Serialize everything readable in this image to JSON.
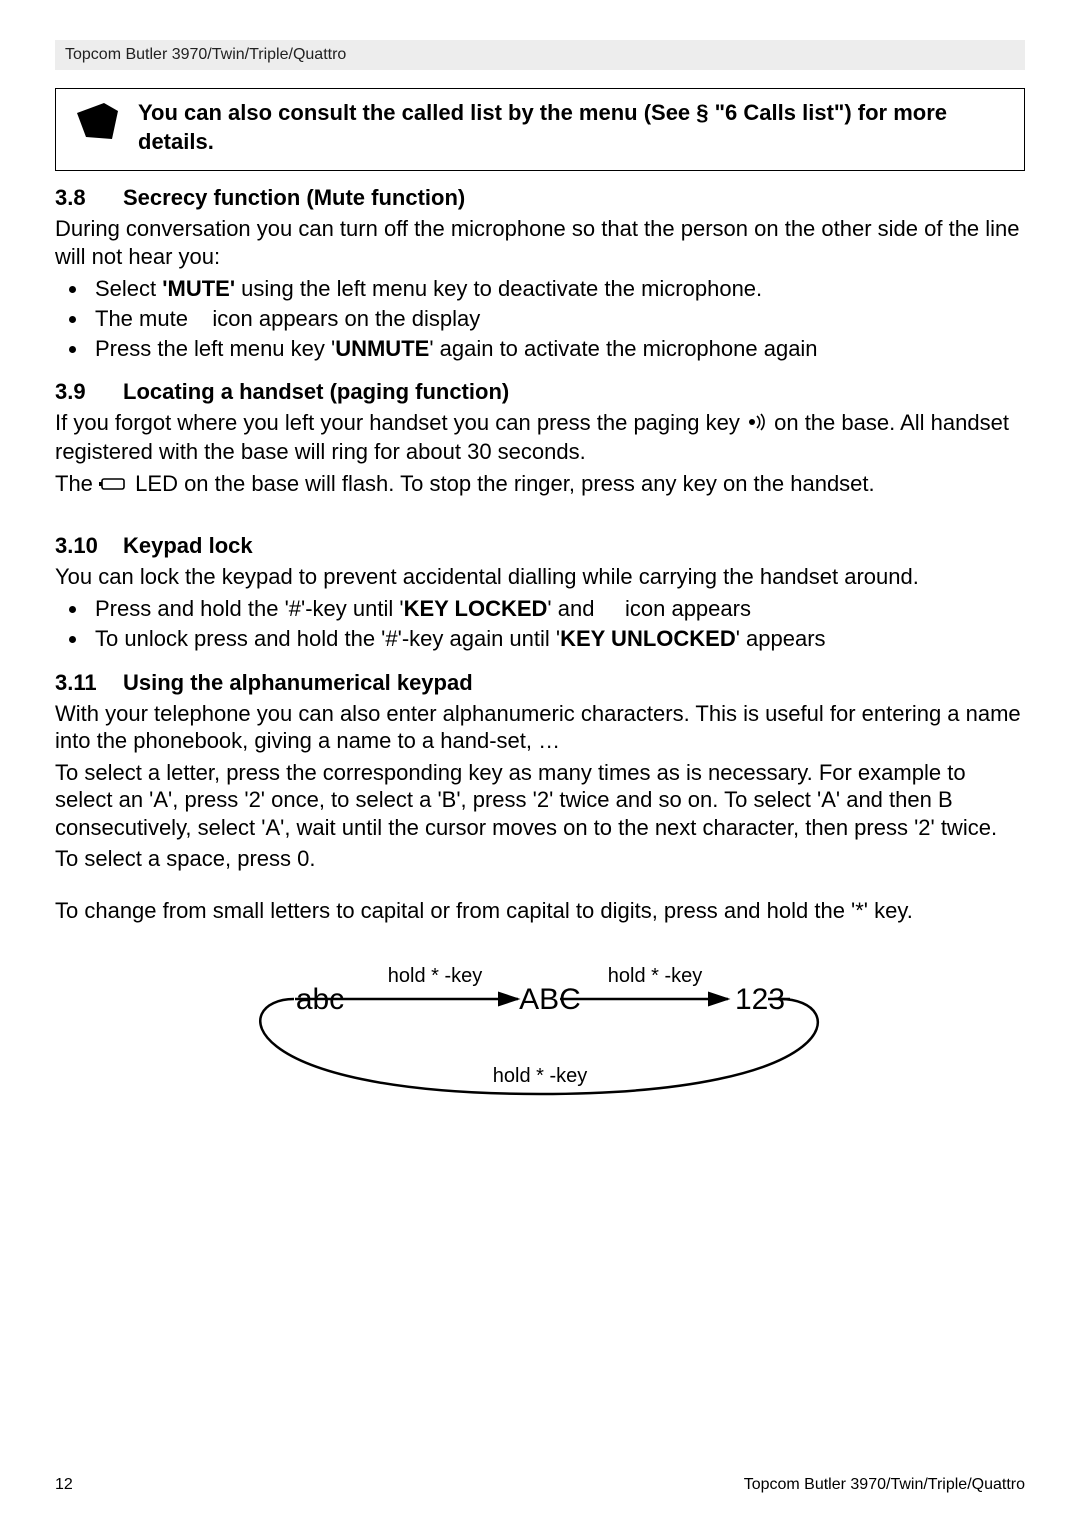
{
  "header": {
    "title": "Topcom Butler 3970/Twin/Triple/Quattro"
  },
  "note": {
    "text": "You can also consult the called list by the menu (See § \"6 Calls list\") for more details."
  },
  "s38": {
    "num": "3.8",
    "title": "Secrecy function (Mute function)",
    "p1": "During conversation you can turn off the microphone so that the person on the other side of the line will not hear you:",
    "li1_a": "Select ",
    "li1_b": "'MUTE'",
    "li1_c": " using the left menu key to deactivate the microphone.",
    "li2": "The mute    icon appears on the display",
    "li3_a": "Press the left menu key '",
    "li3_b": "UNMUTE",
    "li3_c": "' again to activate the microphone again"
  },
  "s39": {
    "num": "3.9",
    "title": "Locating a handset (paging function)",
    "p1_a": "If you forgot where you left your handset you can press the paging key ",
    "p1_b": " on the base. All handset registered with the base will ring for about 30 seconds.",
    "p2_a": "The ",
    "p2_b": " LED on the base will flash. To stop the ringer, press any key on the handset."
  },
  "s310": {
    "num": "3.10",
    "title": "Keypad lock",
    "p1": "You can lock the keypad to prevent accidental dialling while carrying the handset around.",
    "li1_a": "Press and hold the '#'-key until '",
    "li1_b": "KEY LOCKED",
    "li1_c": "' and     icon appears",
    "li2_a": "To unlock press and hold the '#'-key again until '",
    "li2_b": "KEY UNLOCKED",
    "li2_c": "' appears"
  },
  "s311": {
    "num": "3.11",
    "title": "Using the alphanumerical keypad",
    "p1": "With your telephone you can also enter alphanumeric characters. This is useful for entering a name into the phonebook, giving a name to a hand-set, …",
    "p2": "To select a letter, press the corresponding key as many times as is necessary. For example to select an 'A', press '2' once, to select a 'B', press '2' twice and so on. To select 'A' and then B consecutively, select 'A', wait until the cursor moves on to the next character, then press '2' twice.",
    "p3": "To select a space, press 0.",
    "p4": "To change from small letters to capital or from capital to digits, press and hold the '*' key."
  },
  "diagram": {
    "abc": "abc",
    "ABC": "ABC",
    "n123": "123",
    "top1": "hold  * -key",
    "top2": "hold  * -key",
    "bottom": "hold  * -key"
  },
  "footer": {
    "page": "12",
    "right": "Topcom Butler 3970/Twin/Triple/Quattro"
  }
}
